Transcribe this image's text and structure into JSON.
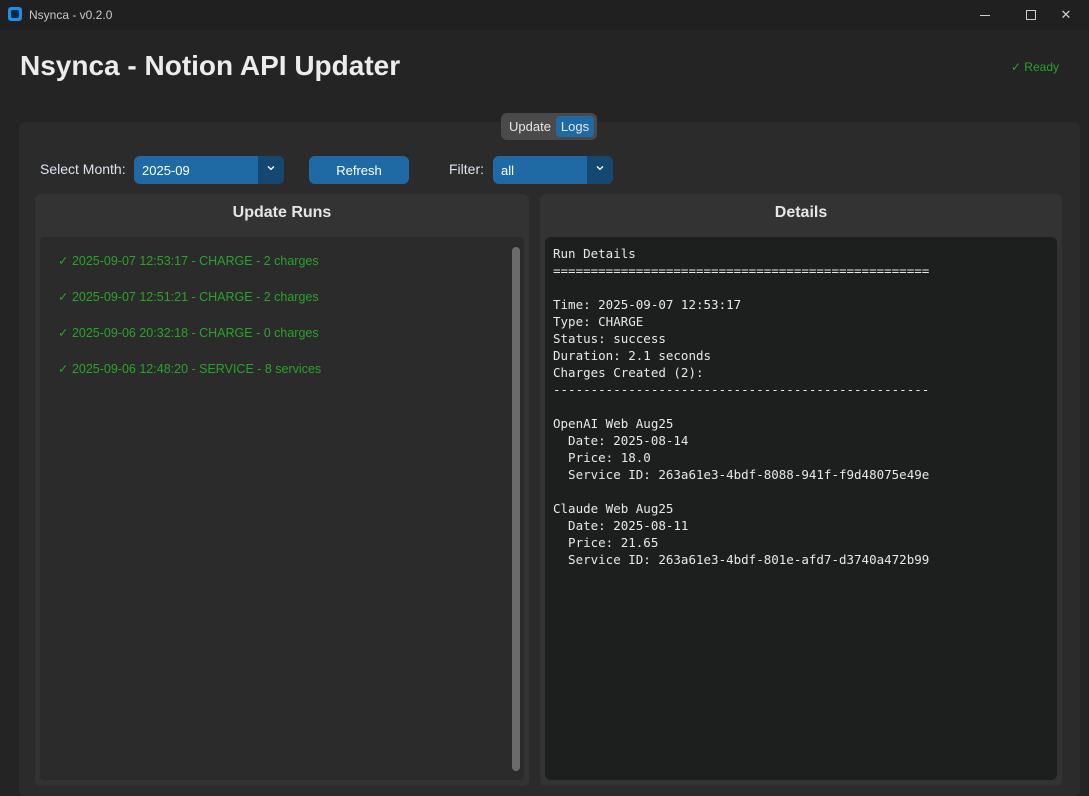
{
  "window": {
    "title": "Nsynca - v0.2.0",
    "min_glyph": "—",
    "close_glyph": "✕"
  },
  "header": {
    "title": "Nsynca - Notion API Updater",
    "status": "✓ Ready",
    "status_color": "#2aa32a"
  },
  "tabs": [
    {
      "label": "Update",
      "active": false
    },
    {
      "label": "Logs",
      "active": true
    }
  ],
  "controls": {
    "month_label": "Select Month:",
    "month_value": "2025-09",
    "refresh_label": "Refresh",
    "filter_label": "Filter:",
    "filter_value": "all",
    "dropdown_icon": "chevron-down-icon"
  },
  "runs_panel": {
    "title": "Update Runs",
    "items": [
      "✓  2025-09-07 12:53:17 - CHARGE - 2 charges",
      "✓  2025-09-07 12:51:21 - CHARGE - 2 charges",
      "✓  2025-09-06 20:32:18 - CHARGE - 0 charges",
      "✓  2025-09-06 12:48:20 - SERVICE - 8 services"
    ]
  },
  "details_panel": {
    "title": "Details",
    "text": "Run Details\n==================================================\n\nTime: 2025-09-07 12:53:17\nType: CHARGE\nStatus: success\nDuration: 2.1 seconds\nCharges Created (2):\n--------------------------------------------------\n\nOpenAI Web Aug25\n  Date: 2025-08-14\n  Price: 18.0\n  Service ID: 263a61e3-4bdf-8088-941f-f9d48075e49e\n\nClaude Web Aug25\n  Date: 2025-08-11\n  Price: 21.65\n  Service ID: 263a61e3-4bdf-801e-afd7-d3740a472b99"
  },
  "colors": {
    "accent": "#1f6aa5",
    "accent_dark": "#144870",
    "success": "#2aa32a",
    "background": "#242424"
  }
}
